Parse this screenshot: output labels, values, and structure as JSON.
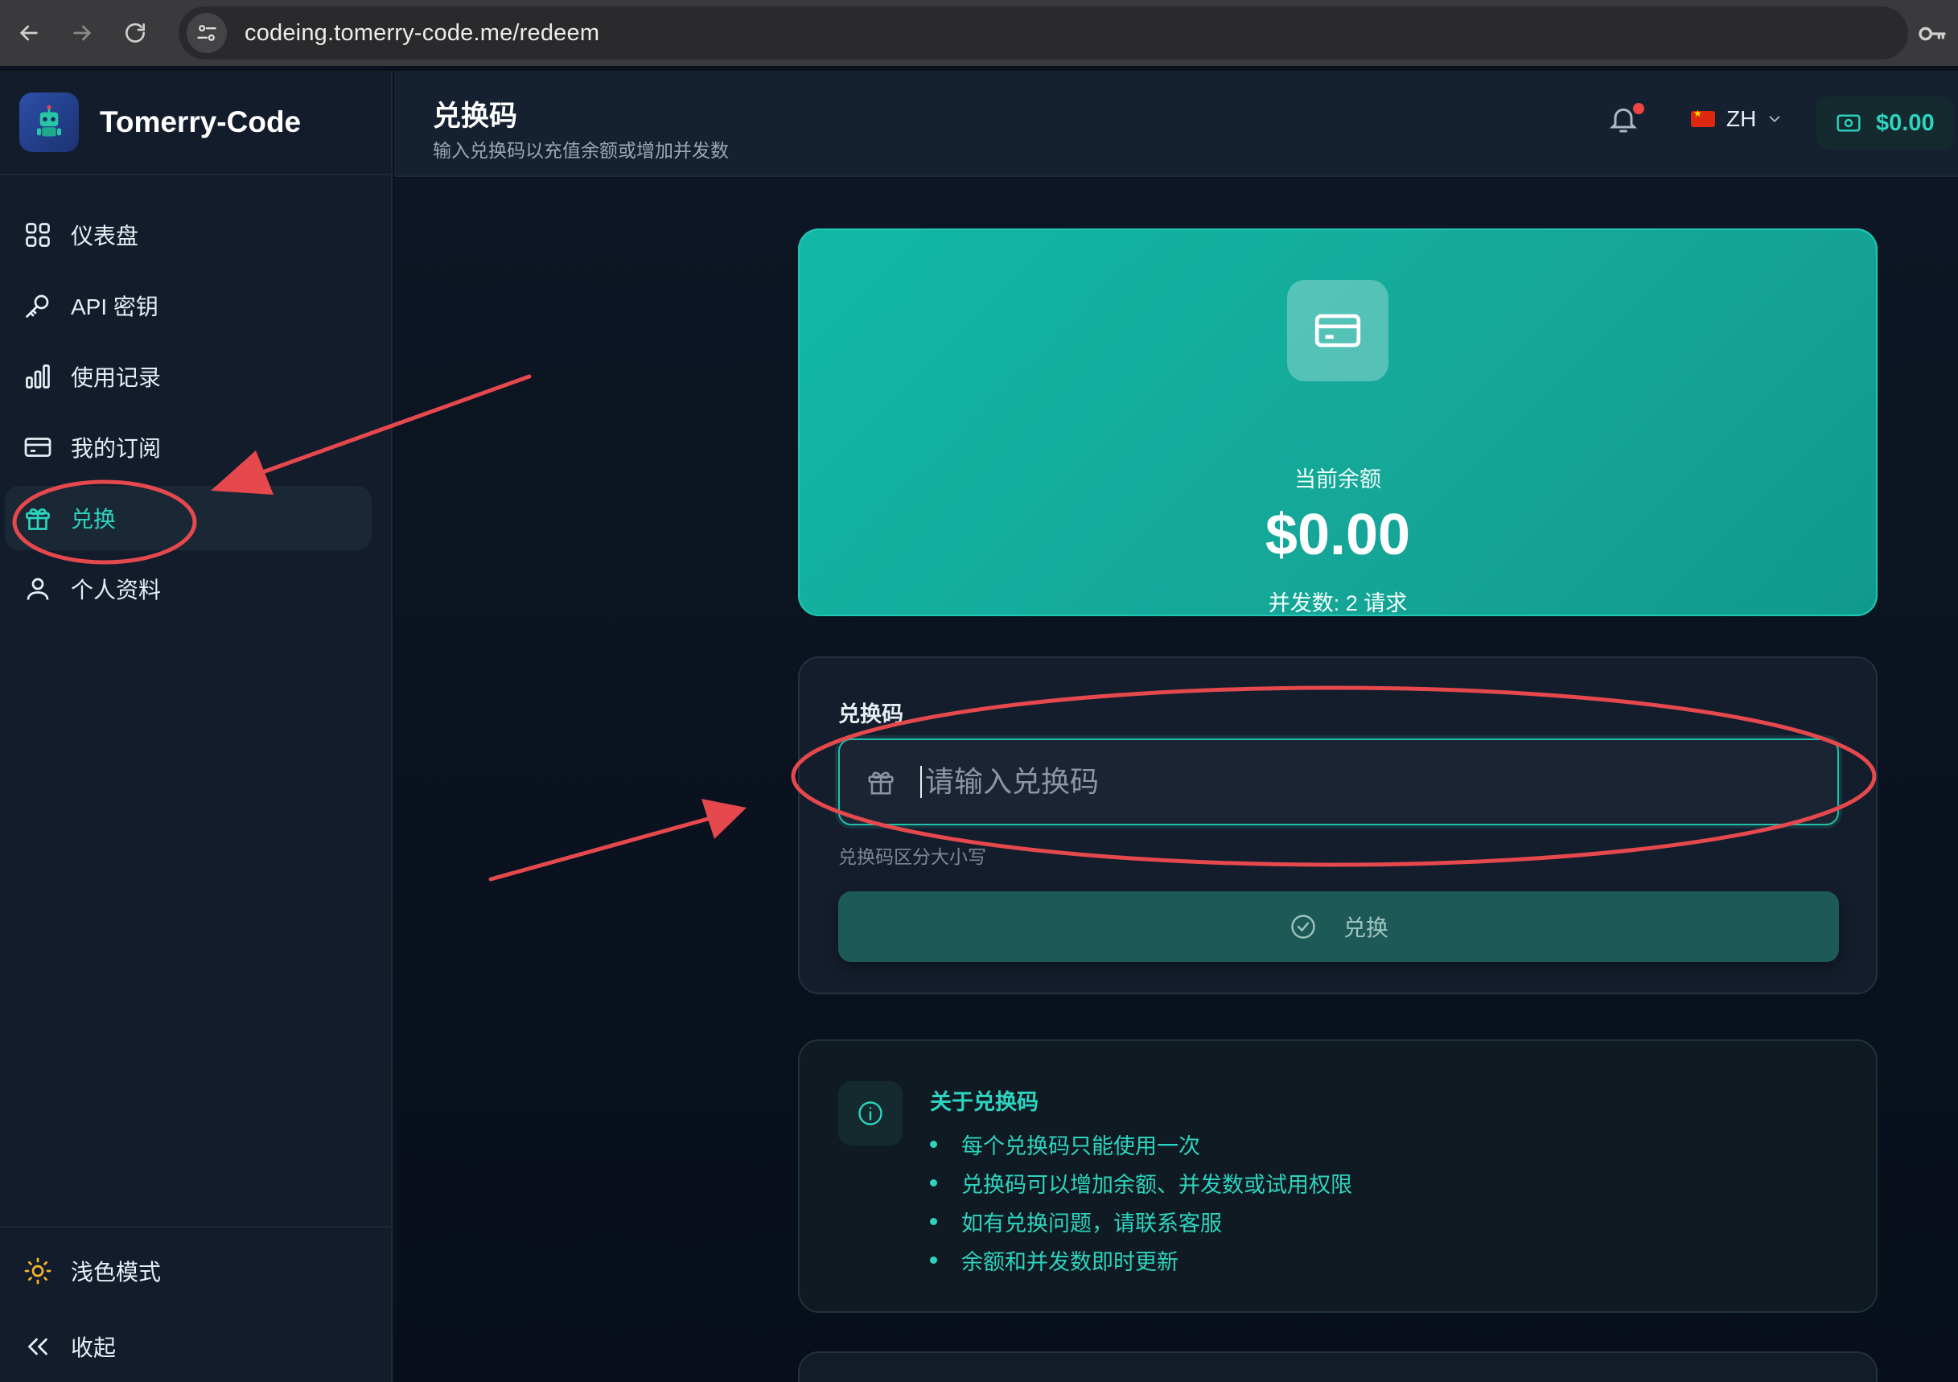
{
  "browser": {
    "url": "codeing.tomerry-code.me/redeem"
  },
  "sidebar": {
    "brand": "Tomerry-Code",
    "items": [
      {
        "label": "仪表盘",
        "icon": "grid-icon"
      },
      {
        "label": "API 密钥",
        "icon": "key-icon"
      },
      {
        "label": "使用记录",
        "icon": "bar-chart-icon"
      },
      {
        "label": "我的订阅",
        "icon": "credit-card-icon"
      },
      {
        "label": "兑换",
        "icon": "gift-icon",
        "active": true
      },
      {
        "label": "个人资料",
        "icon": "user-icon"
      }
    ],
    "bottom": {
      "theme_label": "浅色模式",
      "collapse_label": "收起"
    }
  },
  "header": {
    "title": "兑换码",
    "subtitle": "输入兑换码以充值余额或增加并发数",
    "language": "ZH",
    "balance": "$0.00"
  },
  "balance_card": {
    "label": "当前余额",
    "amount": "$0.00",
    "concurrency": "并发数: 2 请求"
  },
  "redeem_form": {
    "label": "兑换码",
    "placeholder": "请输入兑换码",
    "value": "",
    "hint": "兑换码区分大小写",
    "button_label": "兑换"
  },
  "info": {
    "title": "关于兑换码",
    "items": [
      "每个兑换码只能使用一次",
      "兑换码可以增加余额、并发数或试用权限",
      "如有兑换问题，请联系客服",
      "余额和并发数即时更新"
    ]
  },
  "colors": {
    "accent": "#2dd4bf",
    "annotation": "#e5484d",
    "notification_dot": "#ef4444"
  }
}
